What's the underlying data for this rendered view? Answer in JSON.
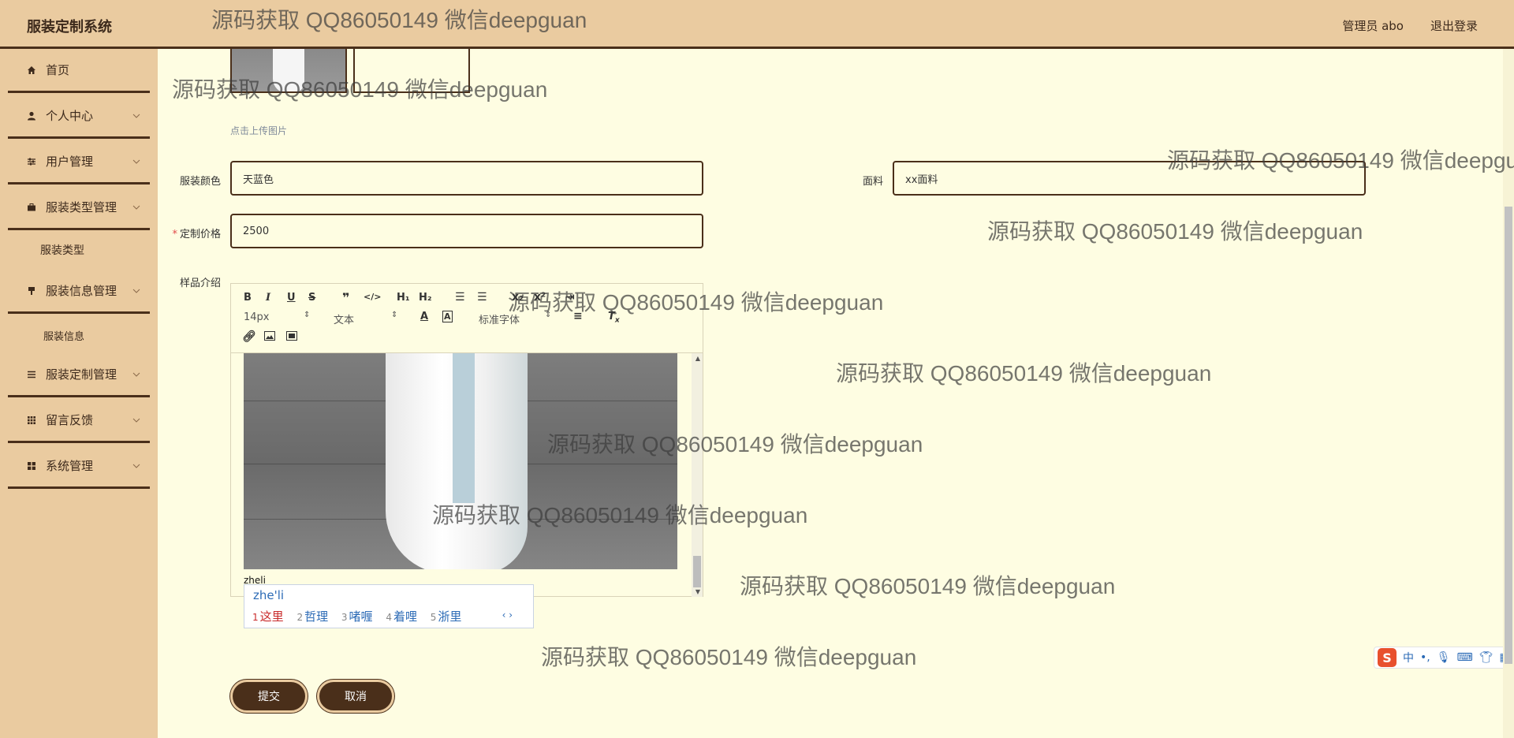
{
  "header": {
    "brand": "服装定制系统",
    "user": "管理员 abo",
    "logout": "退出登录"
  },
  "sidebar": {
    "items": [
      {
        "label": "首页",
        "icon": "home-icon"
      },
      {
        "label": "个人中心",
        "icon": "user-icon"
      },
      {
        "label": "用户管理",
        "icon": "sliders-icon"
      },
      {
        "label": "服装类型管理",
        "icon": "briefcase-icon"
      },
      {
        "label": "服装信息管理",
        "icon": "tag-icon"
      },
      {
        "label": "服装定制管理",
        "icon": "list-icon"
      },
      {
        "label": "留言反馈",
        "icon": "grid-icon"
      },
      {
        "label": "系统管理",
        "icon": "apps-icon"
      }
    ],
    "sub_items": {
      "type": "服装类型",
      "info": "服装信息"
    }
  },
  "form": {
    "upload_hint": "点击上传图片",
    "color_label": "服装颜色",
    "color_value": "天蓝色",
    "fabric_label": "面料",
    "fabric_value": "xx面料",
    "price_required": "*",
    "price_label": "定制价格",
    "price_value": "2500",
    "intro_label": "样品介绍"
  },
  "editor": {
    "font_size": "14px",
    "paragraph": "文本",
    "font_family": "标准字体",
    "typed_text": "zheli"
  },
  "ime": {
    "pinyin": "zhe'li",
    "candidates": [
      {
        "n": "1",
        "text": "这里"
      },
      {
        "n": "2",
        "text": "哲理"
      },
      {
        "n": "3",
        "text": "啫喱"
      },
      {
        "n": "4",
        "text": "着哩"
      },
      {
        "n": "5",
        "text": "浙里"
      }
    ],
    "status": "中"
  },
  "buttons": {
    "submit": "提交",
    "cancel": "取消"
  },
  "watermark": "源码获取 QQ86050149 微信deepguan",
  "colors": {
    "header_bg": "#eacba0",
    "page_bg": "#fefde2",
    "accent": "#4a2f1a"
  }
}
